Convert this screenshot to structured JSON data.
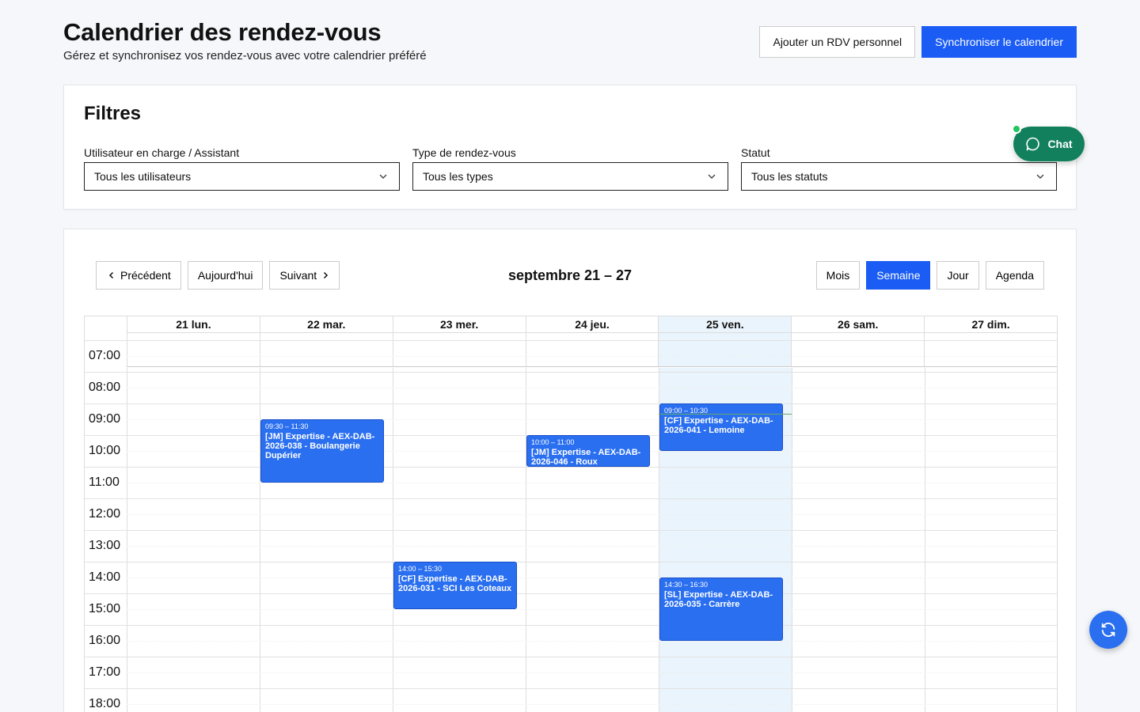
{
  "header": {
    "title": "Calendrier des rendez-vous",
    "subtitle": "Gérez et synchronisez vos rendez-vous avec votre calendrier préféré",
    "add_button": "Ajouter un RDV personnel",
    "sync_button": "Synchroniser le calendrier"
  },
  "filters": {
    "title": "Filtres",
    "user_label": "Utilisateur en charge / Assistant",
    "user_value": "Tous les utilisateurs",
    "type_label": "Type de rendez-vous",
    "type_value": "Tous les types",
    "status_label": "Statut",
    "status_value": "Tous les statuts"
  },
  "chat": {
    "label": "Chat",
    "accent": "#12805c"
  },
  "toolbar": {
    "prev": "Précédent",
    "today": "Aujourd'hui",
    "next": "Suivant",
    "range": "septembre 21 – 27",
    "views": [
      "Mois",
      "Semaine",
      "Jour",
      "Agenda"
    ],
    "active_view": "Semaine"
  },
  "days": [
    "21 lun.",
    "22 mar.",
    "23 mer.",
    "24 jeu.",
    "25 ven.",
    "26 sam.",
    "27 dim."
  ],
  "today_index": 4,
  "hours": [
    "07:00",
    "08:00",
    "09:00",
    "10:00",
    "11:00",
    "12:00",
    "13:00",
    "14:00",
    "15:00",
    "16:00",
    "17:00",
    "18:00"
  ],
  "events": [
    {
      "day": 1,
      "start": "09:30",
      "end": "11:30",
      "time": "09:30 – 11:30",
      "title": "[JM] Expertise - AEX-DAB-2026-038 - Boulangerie Dupérier"
    },
    {
      "day": 2,
      "start": "14:00",
      "end": "15:30",
      "time": "14:00 – 15:30",
      "title": "[CF] Expertise - AEX-DAB-2026-031 - SCI Les Coteaux"
    },
    {
      "day": 3,
      "start": "10:00",
      "end": "11:00",
      "time": "10:00 – 11:00",
      "title": "[JM] Expertise - AEX-DAB-2026-046 - Roux"
    },
    {
      "day": 4,
      "start": "09:00",
      "end": "10:30",
      "time": "09:00 – 10:30",
      "title": "[CF] Expertise - AEX-DAB-2026-041 - Lemoine"
    },
    {
      "day": 4,
      "start": "14:30",
      "end": "16:30",
      "time": "14:30 – 16:30",
      "title": "[SL] Expertise - AEX-DAB-2026-035 - Carrère"
    }
  ],
  "colors": {
    "primary": "#1a5cf4",
    "event": "#2a6ff0",
    "today_bg": "#eaf4fc"
  }
}
